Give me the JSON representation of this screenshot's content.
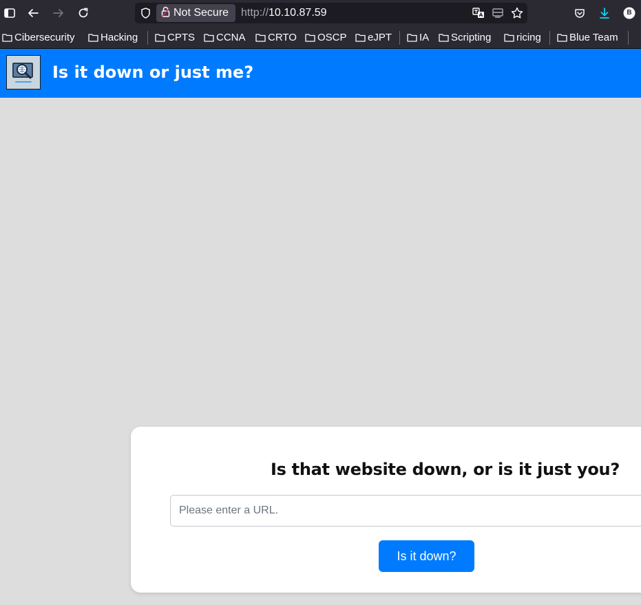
{
  "browser": {
    "security_label": "Not Secure",
    "url_protocol": "http://",
    "url_host": "10.10.87.59",
    "profile_initial": "B",
    "download_accent": "#00ddff"
  },
  "bookmarks": [
    "Cibersecurity",
    "Hacking",
    "CPTS",
    "CCNA",
    "CRTO",
    "OSCP",
    "eJPT",
    "IA",
    "Scripting",
    "ricing",
    "Blue Team"
  ],
  "header": {
    "title": "Is it down or just me?",
    "color": "#007bff"
  },
  "form": {
    "heading": "Is that website down, or is it just you?",
    "placeholder": "Please enter a URL.",
    "button_label": "Is it down?"
  }
}
